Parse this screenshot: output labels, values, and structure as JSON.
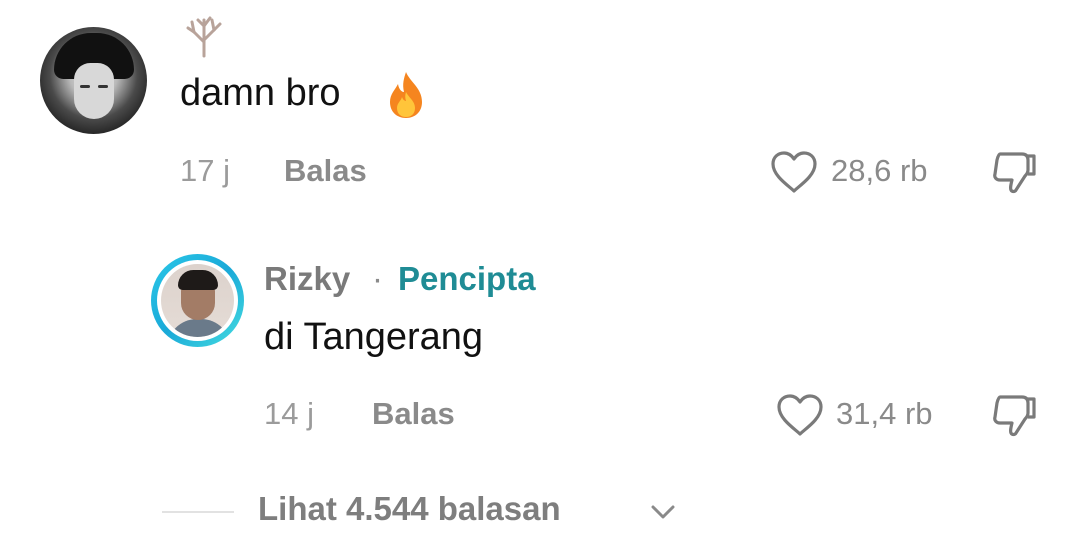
{
  "comment": {
    "text": "damn bro",
    "time": "17 j",
    "reply_label": "Balas",
    "likes": "28,6 rb"
  },
  "reply": {
    "username": "Rizky",
    "separator": "·",
    "creator_badge": "Pencipta",
    "text": "di Tangerang",
    "time": "14 j",
    "reply_label": "Balas",
    "likes": "31,4 rb"
  },
  "thread": {
    "view_replies": "Lihat 4.544 balasan"
  },
  "colors": {
    "creator": "#1f8c95",
    "meta": "#8a8a8a",
    "ring": "#1aa9d8"
  },
  "icons": [
    "tree-icon",
    "fire-emoji-icon",
    "heart-icon",
    "dislike-icon",
    "chevron-down-icon"
  ]
}
